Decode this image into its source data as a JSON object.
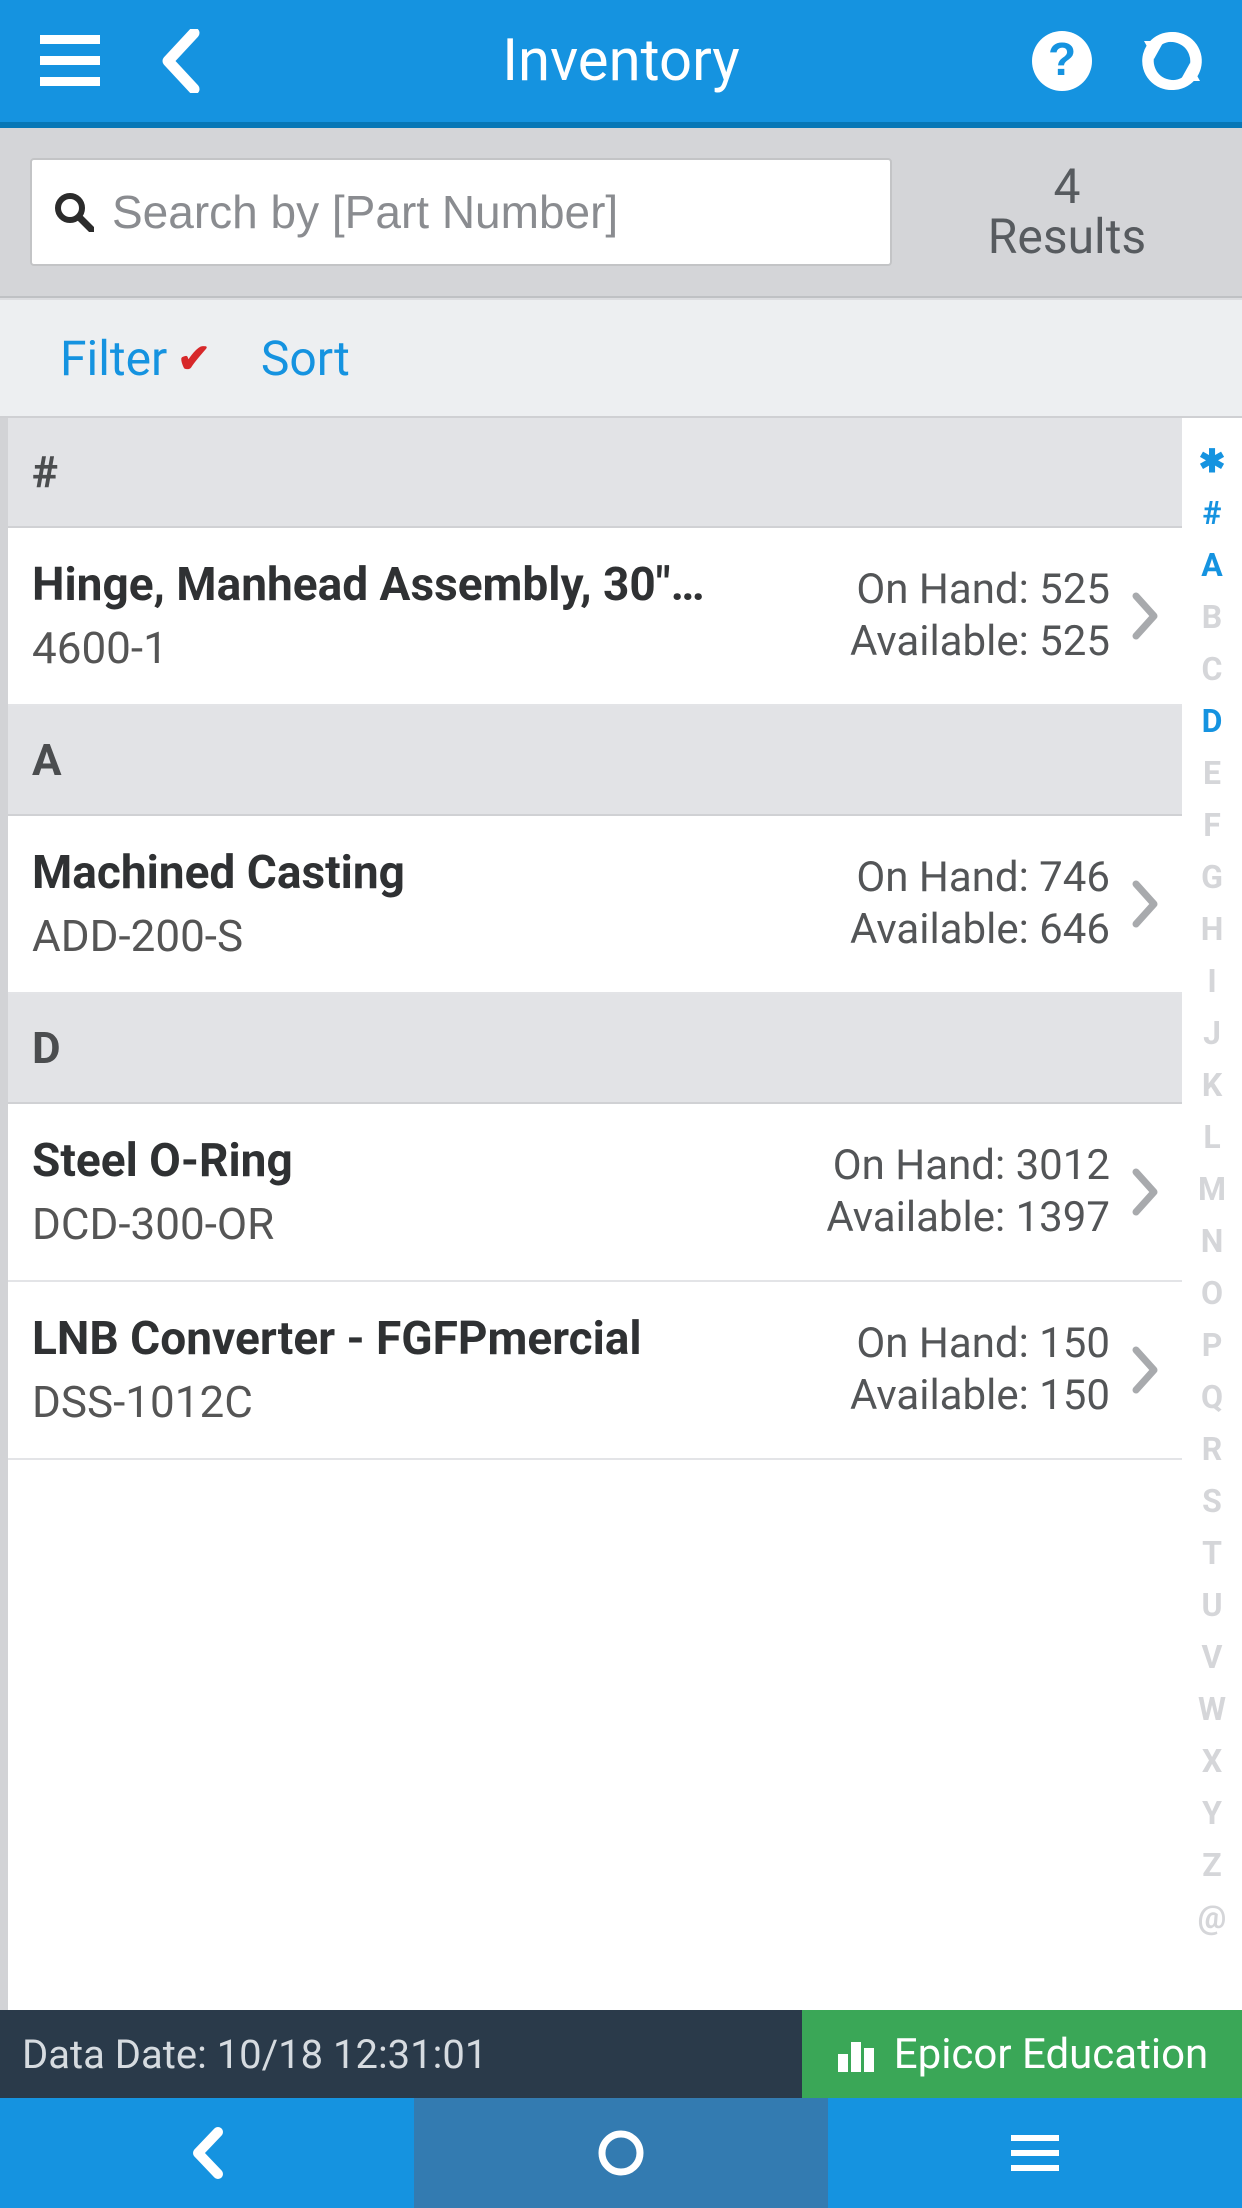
{
  "header": {
    "title": "Inventory"
  },
  "search": {
    "placeholder": "Search by [Part Number]",
    "results_count": "4",
    "results_label": "Results"
  },
  "toolbar": {
    "filter_label": "Filter",
    "filter_active": true,
    "sort_label": "Sort"
  },
  "sections": [
    {
      "header": "#",
      "items": [
        {
          "name": "Hinge, Manhead Assembly, 30\"…",
          "part": "4600-1",
          "on_hand_label": "On Hand:",
          "on_hand": "525",
          "available_label": "Available:",
          "available": "525"
        }
      ]
    },
    {
      "header": "A",
      "items": [
        {
          "name": "Machined Casting",
          "part": "ADD-200-S",
          "on_hand_label": "On Hand:",
          "on_hand": "746",
          "available_label": "Available:",
          "available": "646"
        }
      ]
    },
    {
      "header": "D",
      "items": [
        {
          "name": "Steel O-Ring",
          "part": "DCD-300-OR",
          "on_hand_label": "On Hand:",
          "on_hand": "3012",
          "available_label": "Available:",
          "available": "1397"
        },
        {
          "name": "LNB Converter - FGFPmercial",
          "part": "DSS-1012C",
          "on_hand_label": "On Hand:",
          "on_hand": "150",
          "available_label": "Available:",
          "available": "150"
        }
      ]
    }
  ],
  "alpha_index": {
    "entries": [
      "✱",
      "#",
      "A",
      "B",
      "C",
      "D",
      "E",
      "F",
      "G",
      "H",
      "I",
      "J",
      "K",
      "L",
      "M",
      "N",
      "O",
      "P",
      "Q",
      "R",
      "S",
      "T",
      "U",
      "V",
      "W",
      "X",
      "Y",
      "Z",
      "@"
    ],
    "active": [
      "✱",
      "#",
      "A",
      "D"
    ]
  },
  "footer": {
    "data_date_label": "Data Date:",
    "data_date_value": "10/18 12:31:01",
    "brand": "Epicor Education"
  }
}
